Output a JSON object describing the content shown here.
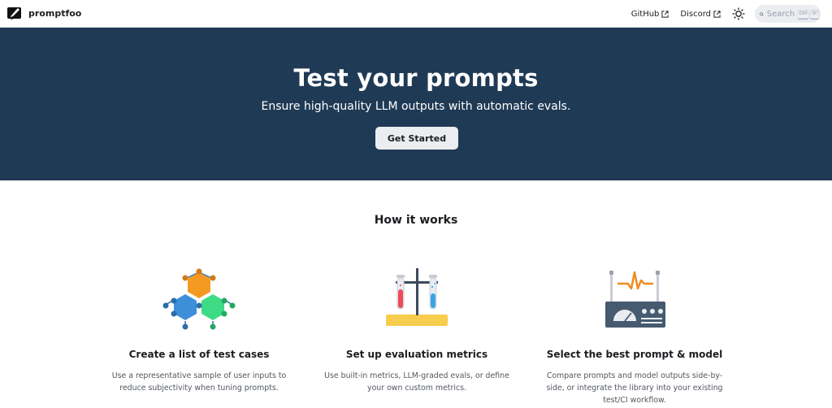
{
  "navbar": {
    "brand": "promptfoo",
    "links": [
      {
        "label": "GitHub",
        "icon": "external-link-icon"
      },
      {
        "label": "Discord",
        "icon": "external-link-icon"
      }
    ],
    "theme_icon": "sun-icon",
    "search": {
      "placeholder": "Search",
      "shortcut": [
        "Ctrl",
        "K"
      ]
    }
  },
  "hero": {
    "title": "Test your prompts",
    "subtitle": "Ensure high-quality LLM outputs with automatic evals.",
    "button": "Get Started",
    "background": "#1f3a55"
  },
  "how_it_works": {
    "title": "How it works",
    "features": [
      {
        "icon": "hexagon-molecule-icon",
        "title": "Create a list of test cases",
        "description": "Use a representative sample of user inputs to reduce subjectivity when tuning prompts."
      },
      {
        "icon": "test-tubes-icon",
        "title": "Set up evaluation metrics",
        "description": "Use built-in metrics, LLM-graded evals, or define your own custom metrics."
      },
      {
        "icon": "gauge-device-icon",
        "title": "Select the best prompt & model",
        "description": "Compare prompts and model outputs side-by-side, or integrate the library into your existing test/CI workflow."
      }
    ]
  }
}
